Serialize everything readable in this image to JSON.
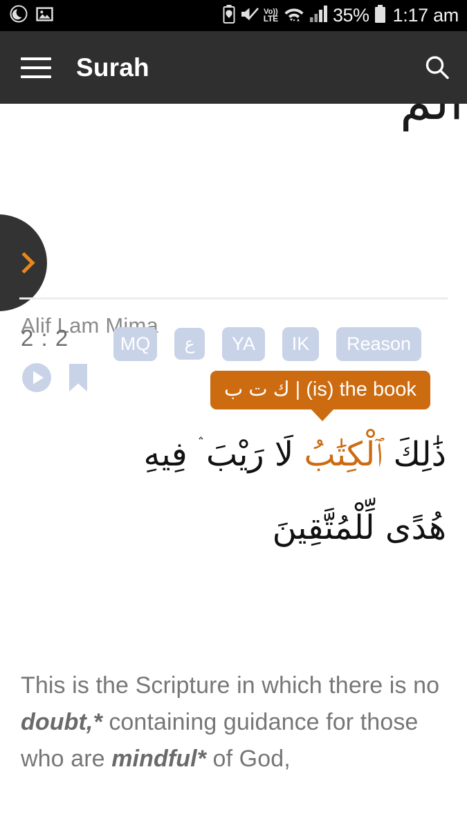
{
  "status_bar": {
    "left_icons": [
      "do-not-disturb-moon-icon",
      "screenshot-image-icon"
    ],
    "right_icons": [
      "battery-saver-icon",
      "mute-icon",
      "volte-icon",
      "wifi-icon",
      "signal-icon",
      "battery-icon"
    ],
    "volte_top": "Vo))",
    "volte_bottom": "LTE",
    "battery_percent": "35%",
    "time": "1:17 am"
  },
  "app_bar": {
    "menu_icon": "hamburger-menu-icon",
    "title": "Surah",
    "search_icon": "search-icon"
  },
  "content": {
    "clipped_arabic_top": "الم",
    "next_button_icon": "chevron-right-icon",
    "surah_subtitle": "Alif Lam Mima",
    "verse": {
      "number": "2 : 2",
      "play_icon": "play-circle-icon",
      "bookmark_icon": "bookmark-icon",
      "tags": [
        {
          "label": "MQ",
          "class": "tag-mq"
        },
        {
          "label": "ع",
          "class": "tag-ain"
        },
        {
          "label": "YA",
          "class": "tag-ya"
        },
        {
          "label": "IK",
          "class": "tag-ik"
        },
        {
          "label": "Reason",
          "class": "tag-reason"
        }
      ],
      "tooltip": {
        "root": "ك ت ب",
        "separator": "|",
        "gloss": "(is) the book",
        "full": "ك ت ب  |  (is) the book"
      },
      "arabic_line1_pre": "ذَٰلِكَ ",
      "arabic_line1_highlight": "ٱلْكِتَٰبُ",
      "arabic_line1_post": " لَا رَيْبَ ۛ فِيهِ",
      "arabic_line2": "هُدًى لِّلْمُتَّقِينَ",
      "translation_part1": "This is the Scripture in which there is no ",
      "translation_bold1": "doubt,*",
      "translation_part2": " containing guidance for those who are ",
      "translation_bold2": "mindful*",
      "translation_part3": " of God,"
    }
  },
  "colors": {
    "accent_orange": "#cc6b10",
    "chevron_orange": "#e8871e",
    "tag_blue": "#c8d3e8",
    "app_bar_dark": "#2f2f2f",
    "status_bar_black": "#000000",
    "text_gray": "#767676"
  }
}
